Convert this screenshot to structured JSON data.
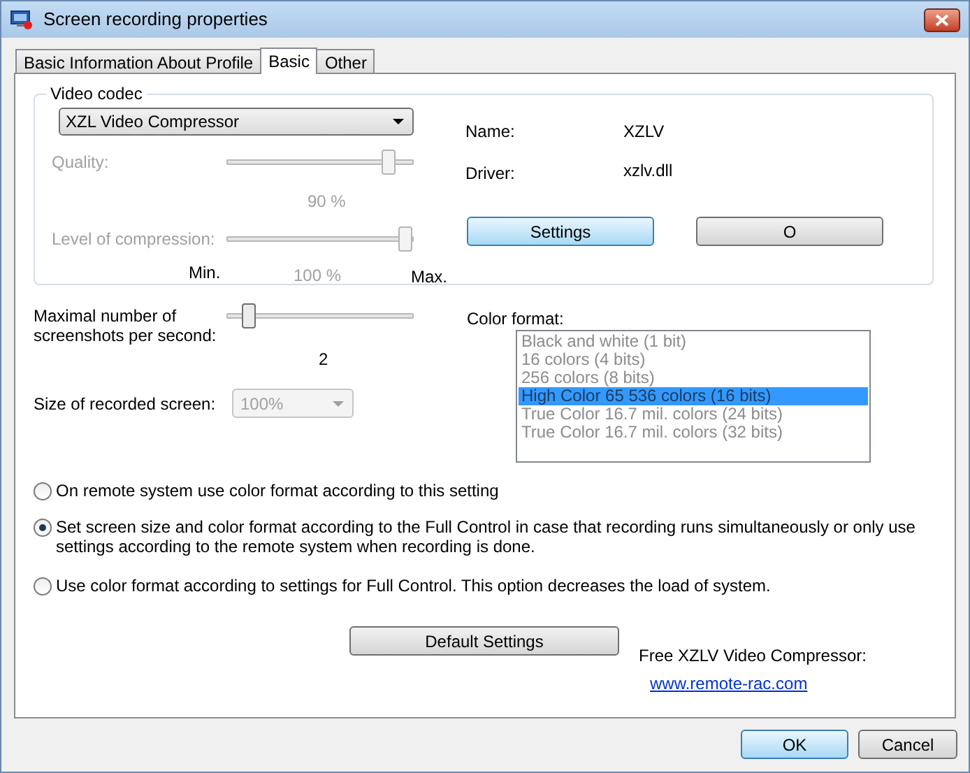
{
  "window": {
    "title": "Screen recording properties"
  },
  "tabs": [
    {
      "label": "Basic Information About Profile",
      "selected": false
    },
    {
      "label": "Basic",
      "selected": true
    },
    {
      "label": "Other",
      "selected": false
    }
  ],
  "video_codec": {
    "title": "Video codec",
    "codec": "XZL Video Compressor",
    "quality": {
      "label": "Quality:",
      "disabled": true,
      "level": 0.9,
      "reading": "90 %"
    },
    "compression": {
      "label": "Level of compression:",
      "disabled": true,
      "level": 1,
      "reading": "100 %",
      "min_label": "Min.",
      "max_label": "Max."
    },
    "name_label": "Name:",
    "name_value": "XZLV",
    "driver_label": "Driver:",
    "driver_value": "xzlv.dll",
    "buttons": [
      {
        "label": "Settings",
        "focused": true
      },
      {
        "label": "O",
        "focused": false
      }
    ]
  },
  "screenshots": {
    "label": "Maximal number of screenshots per second:",
    "disabled": false,
    "level": 0.1,
    "reading": "2"
  },
  "screen_size": {
    "label": "Size of recorded screen:",
    "value": "100%",
    "disabled": true
  },
  "color_format": {
    "label": "Color format:",
    "disabled": true,
    "items": [
      {
        "label": "Black and white (1 bit)",
        "selected": false
      },
      {
        "label": "16 colors (4 bits)",
        "selected": false
      },
      {
        "label": "256 colors (8 bits)",
        "selected": false
      },
      {
        "label": "High Color 65 536 colors (16 bits)",
        "selected": true
      },
      {
        "label": "True Color 16.7 mil. colors (24 bits)",
        "selected": false
      },
      {
        "label": "True Color 16.7 mil. colors (32 bits)",
        "selected": false
      }
    ]
  },
  "radios": [
    {
      "label": "On remote system use color format according to this setting",
      "selected": false
    },
    {
      "label": "Set screen size and color format according to the Full Control in case that recording runs simultaneously or only use settings according to the remote system when recording is done.",
      "selected": true
    },
    {
      "label": "Use color format according to settings for Full Control. This option decreases the load of system.",
      "selected": false
    }
  ],
  "default_button": "Default Settings",
  "promo": {
    "text": "Free XZLV Video Compressor:",
    "link": "www.remote-rac.com"
  },
  "footer_buttons": [
    {
      "label": "OK",
      "default": true
    },
    {
      "label": "Cancel",
      "default": false
    }
  ]
}
